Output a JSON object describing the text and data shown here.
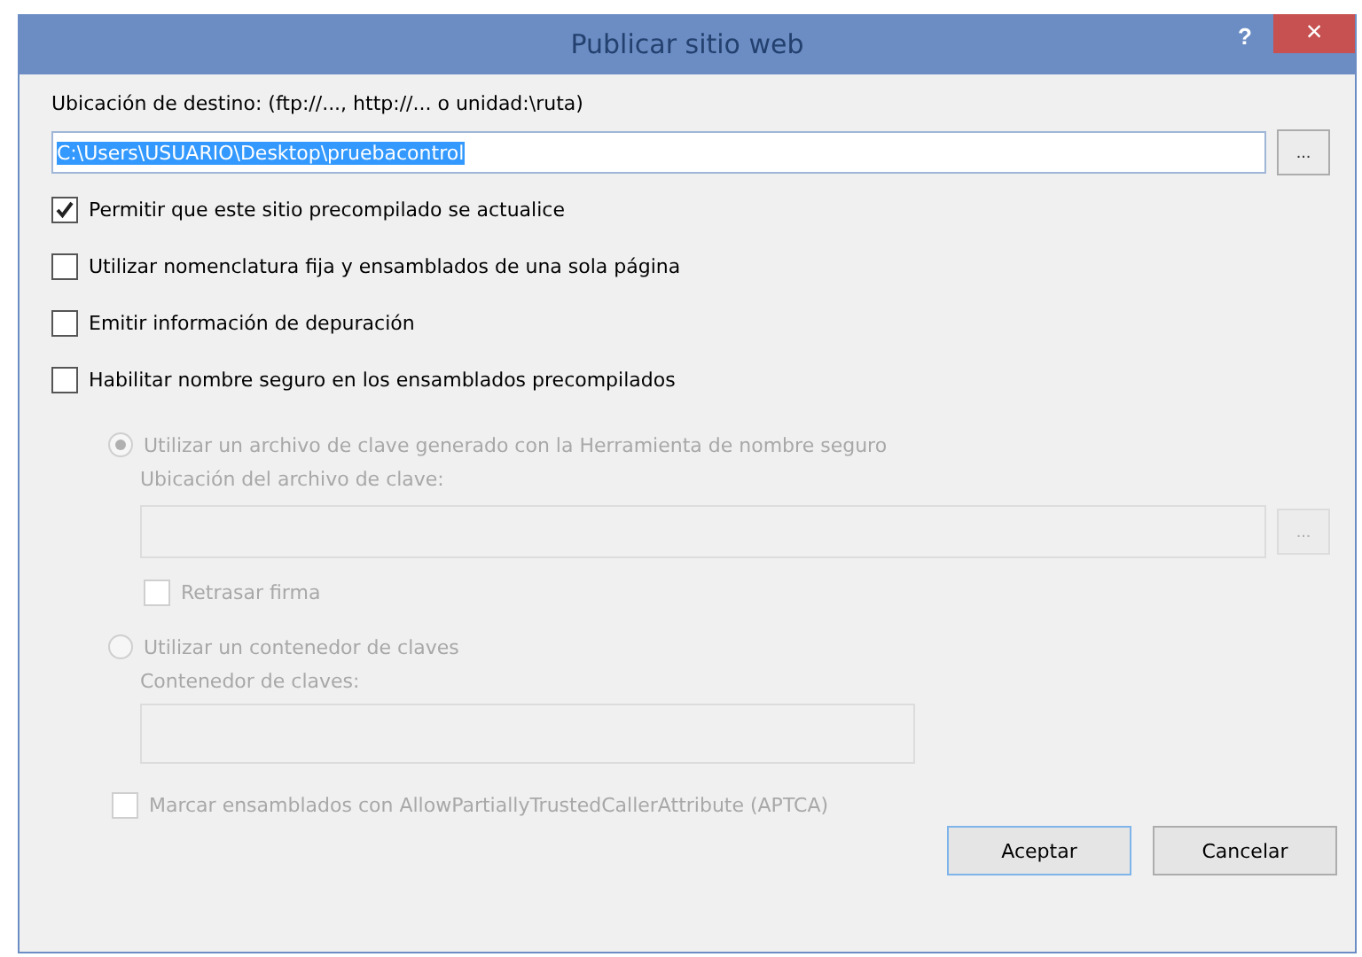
{
  "window": {
    "title": "Publicar sitio web",
    "help": "?",
    "close": "×"
  },
  "target": {
    "label": "Ubicación de destino: (ftp://..., http://... o unidad:\\ruta)",
    "value": "C:\\Users\\USUARIO\\Desktop\\pruebacontrol",
    "browse": "..."
  },
  "options": [
    {
      "label": "Permitir que este sitio precompilado se actualice",
      "checked": true,
      "disabled": false
    },
    {
      "label": "Utilizar nomenclatura fija y ensamblados de una sola página",
      "checked": false,
      "disabled": false
    },
    {
      "label": "Emitir información de depuración",
      "checked": false,
      "disabled": false
    },
    {
      "label": "Habilitar nombre seguro en los ensamblados precompilados",
      "checked": false,
      "disabled": false
    }
  ],
  "strong_name": {
    "disabled": true,
    "key_file": {
      "label": "Utilizar un archivo de clave generado con la Herramienta de nombre seguro",
      "selected": true,
      "field_label": "Ubicación del archivo de clave:",
      "browse": "...",
      "delay_sign": {
        "label": "Retrasar firma",
        "checked": false
      }
    },
    "key_container": {
      "label": "Utilizar un contenedor de claves",
      "selected": false,
      "field_label": "Contenedor de claves:"
    },
    "aptca": {
      "label": "Marcar ensamblados con AllowPartiallyTrustedCallerAttribute (APTCA)",
      "checked": false
    }
  },
  "buttons": [
    {
      "label": "Aceptar",
      "default": true
    },
    {
      "label": "Cancelar",
      "default": false
    }
  ]
}
